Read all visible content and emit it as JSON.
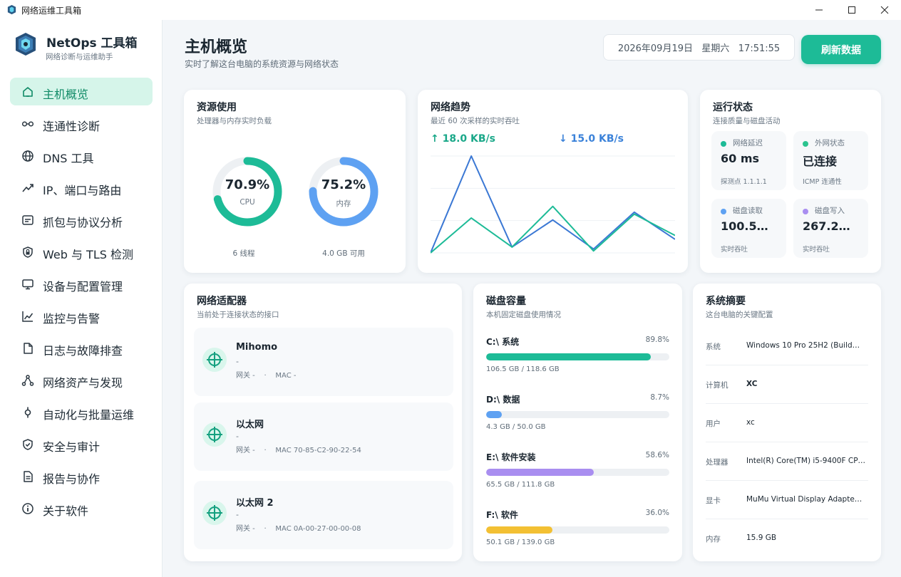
{
  "window": {
    "title": "网络运维工具箱"
  },
  "brand": {
    "name": "NetOps 工具箱",
    "subtitle": "网络诊断与运维助手"
  },
  "nav": [
    {
      "label": "主机概览",
      "icon": "home-icon",
      "active": true
    },
    {
      "label": "连通性诊断",
      "icon": "link-icon"
    },
    {
      "label": "DNS 工具",
      "icon": "globe-icon"
    },
    {
      "label": "IP、端口与路由",
      "icon": "route-icon"
    },
    {
      "label": "抓包与协议分析",
      "icon": "capture-icon"
    },
    {
      "label": "Web 与 TLS 检测",
      "icon": "shield-lock-icon"
    },
    {
      "label": "设备与配置管理",
      "icon": "monitor-icon"
    },
    {
      "label": "监控与告警",
      "icon": "chart-line-icon"
    },
    {
      "label": "日志与故障排查",
      "icon": "document-icon"
    },
    {
      "label": "网络资产与发现",
      "icon": "network-nodes-icon"
    },
    {
      "label": "自动化与批量运维",
      "icon": "automation-icon"
    },
    {
      "label": "安全与审计",
      "icon": "shield-check-icon"
    },
    {
      "label": "报告与协作",
      "icon": "report-icon"
    },
    {
      "label": "关于软件",
      "icon": "info-icon"
    }
  ],
  "header": {
    "title": "主机概览",
    "subtitle": "实时了解这台电脑的系统资源与网络状态",
    "datetime": "2026年09月19日   星期六   17:51:55",
    "refresh_label": "刷新数据"
  },
  "resource": {
    "title": "资源使用",
    "subtitle": "处理器与内存实时负载",
    "cpu": {
      "value": "70.9%",
      "percent": 70.9,
      "label": "CPU",
      "foot": "6 线程",
      "color": "#1dbb97"
    },
    "mem": {
      "value": "75.2%",
      "percent": 75.2,
      "label": "内存",
      "foot": "4.0 GB 可用",
      "color": "#5ea1f2"
    }
  },
  "trend": {
    "title": "网络趋势",
    "subtitle": "最近 60 次采样的实时吞吐",
    "up": "↑ 18.0 KB/s",
    "down": "↓ 15.0 KB/s",
    "up_color": "#1aa889",
    "down_color": "#3b82d9"
  },
  "chart_data": {
    "type": "line",
    "x": [
      0,
      1,
      2,
      3,
      4,
      5,
      6
    ],
    "ylim": [
      0,
      100
    ],
    "grid": true,
    "series": [
      {
        "color": "#3b78d4",
        "values": [
          0,
          100,
          6,
          34,
          4,
          42,
          14
        ]
      },
      {
        "color": "#1dbb97",
        "values": [
          0,
          36,
          6,
          48,
          2,
          40,
          18
        ]
      }
    ]
  },
  "status": {
    "title": "运行状态",
    "subtitle": "连接质量与磁盘活动",
    "tiles": [
      {
        "label": "网络延迟",
        "value": "60 ms",
        "foot": "探测点 1.1.1.1",
        "color": "#1dbb97"
      },
      {
        "label": "外网状态",
        "value": "已连接",
        "foot": "ICMP 连通性",
        "color": "#2cc48f"
      },
      {
        "label": "磁盘读取",
        "value": "100.5…",
        "foot": "实时吞吐",
        "color": "#5ea1f2"
      },
      {
        "label": "磁盘写入",
        "value": "267.2…",
        "foot": "实时吞吐",
        "color": "#a98ef0"
      }
    ]
  },
  "adapters": {
    "title": "网络适配器",
    "subtitle": "当前处于连接状态的接口",
    "items": [
      {
        "name": "Mihomo",
        "dash": "-",
        "meta": "网关 -    ·    MAC -"
      },
      {
        "name": "以太网",
        "dash": "-",
        "meta": "网关 -    ·    MAC 70-85-C2-90-22-54"
      },
      {
        "name": "以太网 2",
        "dash": "-",
        "meta": "网关 -    ·    MAC 0A-00-27-00-00-08"
      }
    ]
  },
  "disks": {
    "title": "磁盘容量",
    "subtitle": "本机固定磁盘使用情况",
    "items": [
      {
        "name": "C:\\ 系统",
        "pct": "89.8%",
        "percent": 89.8,
        "size": "106.5 GB / 118.6 GB",
        "color": "#1dbb97"
      },
      {
        "name": "D:\\ 数据",
        "pct": "8.7%",
        "percent": 8.7,
        "size": "4.3 GB / 50.0 GB",
        "color": "#5ea1f2"
      },
      {
        "name": "E:\\ 软件安装",
        "pct": "58.6%",
        "percent": 58.6,
        "size": "65.5 GB / 111.8 GB",
        "color": "#a98ef0"
      },
      {
        "name": "F:\\ 软件",
        "pct": "36.0%",
        "percent": 36.0,
        "size": "50.1 GB / 139.0 GB",
        "color": "#f3c033"
      }
    ]
  },
  "system": {
    "title": "系统摘要",
    "subtitle": "这台电脑的关键配置",
    "rows": [
      {
        "k": "系统",
        "v": "Windows 10 Pro 25H2 (Build…"
      },
      {
        "k": "计算机",
        "v": "XC",
        "bold": true
      },
      {
        "k": "用户",
        "v": "xc"
      },
      {
        "k": "处理器",
        "v": "Intel(R) Core(TM) i5-9400F CP…"
      },
      {
        "k": "显卡",
        "v": "MuMu Virtual Display Adapte…"
      },
      {
        "k": "内存",
        "v": "15.9 GB"
      }
    ]
  }
}
